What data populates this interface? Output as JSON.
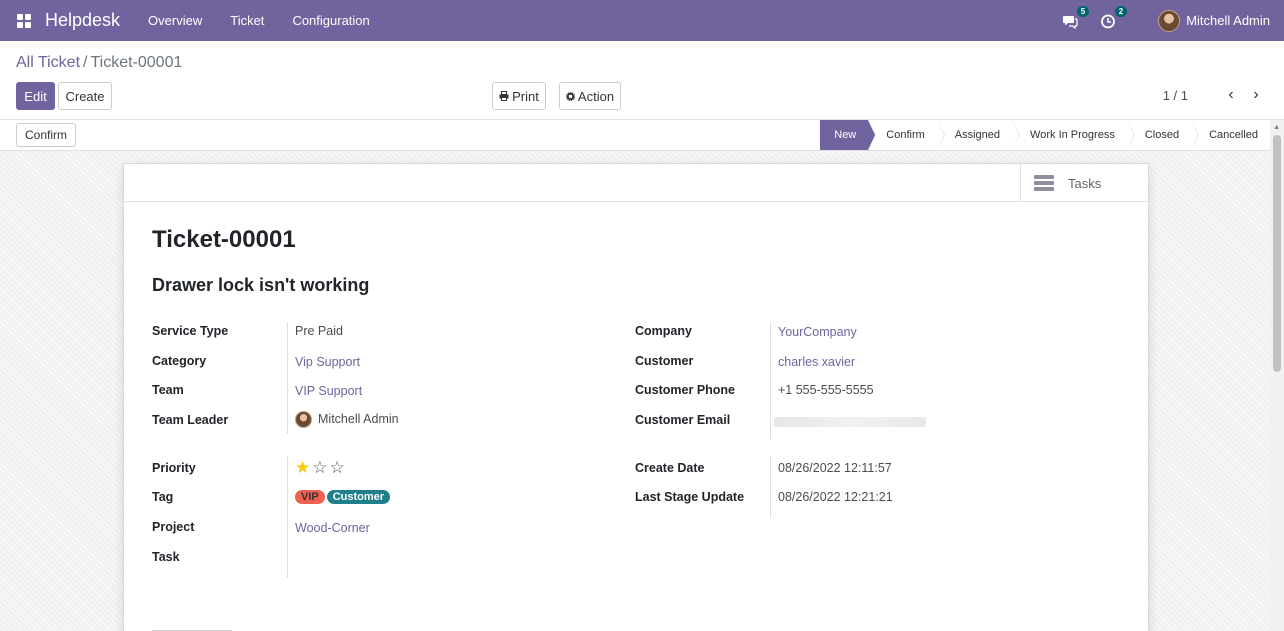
{
  "app": {
    "name": "Helpdesk"
  },
  "nav": {
    "menu": [
      "Overview",
      "Ticket",
      "Configuration"
    ]
  },
  "systray": {
    "messages_count": "5",
    "activities_count": "2",
    "user_name": "Mitchell Admin"
  },
  "breadcrumb": {
    "parent": "All Ticket",
    "separator": "/",
    "current": "Ticket-00001"
  },
  "toolbar": {
    "edit_label": "Edit",
    "create_label": "Create",
    "print_label": "Print",
    "action_label": "Action",
    "pager": "1 / 1"
  },
  "statusbar": {
    "confirm_label": "Confirm",
    "stages": [
      "New",
      "Confirm",
      "Assigned",
      "Work In Progress",
      "Closed",
      "Cancelled"
    ],
    "active_stage": "New"
  },
  "smart_buttons": {
    "tasks_label": "Tasks"
  },
  "ticket": {
    "number": "Ticket-00001",
    "subject": "Drawer lock isn't working",
    "left_fields": {
      "service_type": {
        "label": "Service Type",
        "value": "Pre Paid"
      },
      "category": {
        "label": "Category",
        "value": "Vip Support"
      },
      "team": {
        "label": "Team",
        "value": "VIP Support"
      },
      "team_leader": {
        "label": "Team Leader",
        "value": "Mitchell Admin"
      },
      "priority": {
        "label": "Priority",
        "value": 1,
        "max": 3
      },
      "tag": {
        "label": "Tag",
        "values": [
          "VIP",
          "Customer"
        ]
      },
      "project": {
        "label": "Project",
        "value": "Wood-Corner"
      },
      "task": {
        "label": "Task",
        "value": ""
      }
    },
    "right_fields": {
      "company": {
        "label": "Company",
        "value": "YourCompany"
      },
      "customer": {
        "label": "Customer",
        "value": "charles xavier"
      },
      "customer_phone": {
        "label": "Customer Phone",
        "value": "+1 555-555-5555"
      },
      "customer_email": {
        "label": "Customer Email",
        "value": ""
      },
      "create_date": {
        "label": "Create Date",
        "value": "08/26/2022 12:11:57"
      },
      "last_stage_update": {
        "label": "Last Stage Update",
        "value": "08/26/2022 12:21:21"
      }
    }
  },
  "colors": {
    "brand": "#71639e",
    "badge": "#01666b",
    "tag_vip": "#f06050",
    "tag_customer": "#1f7f8b",
    "star": "#f3cc00"
  }
}
